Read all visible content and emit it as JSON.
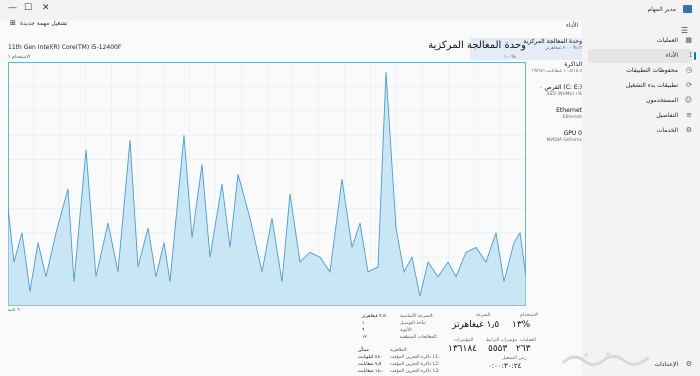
{
  "window": {
    "title": "مدير المهام",
    "controls": {
      "minimize": "—",
      "maximize": "☐",
      "close": "✕"
    }
  },
  "toolbar": {
    "page_title": "الأداء",
    "new_task_label": "تشغيل مهمة جديدة"
  },
  "nav": {
    "items": [
      {
        "label": "العمليات",
        "icon": "grid-icon"
      },
      {
        "label": "الأداء",
        "icon": "chart-icon",
        "active": true
      },
      {
        "label": "محفوظات التطبيقات",
        "icon": "history-icon"
      },
      {
        "label": "تطبيقات بدء التشغيل",
        "icon": "startup-icon"
      },
      {
        "label": "المستخدمون",
        "icon": "users-icon"
      },
      {
        "label": "التفاصيل",
        "icon": "list-icon"
      },
      {
        "label": "الخدمات",
        "icon": "puzzle-icon"
      }
    ],
    "settings_label": "الإعدادات"
  },
  "devices": [
    {
      "name": "وحدة المعالجة المركزية",
      "sub": "١٣% ٢.٠٠ غيغاهرتز",
      "active": true,
      "level": 0.2
    },
    {
      "name": "الذاكرة",
      "sub": "١٠.٥/١٥.٧ غيغابايت (٦٧%)",
      "active": false,
      "level": 0.67
    },
    {
      "name": "القرص ٠ (C: E:)",
      "sub": "SSD (NVMe) ١%",
      "active": false,
      "level": 0.05
    },
    {
      "name": "Ethernet",
      "sub": "Ethernet",
      "active": false,
      "level": 0.05
    },
    {
      "name": "GPU 0",
      "sub": "NVIDIA GeForce",
      "active": false,
      "level": 0.03
    }
  ],
  "cpu": {
    "title": "وحدة المعالجة المركزية",
    "model": "11th Gen Intel(R) Core(TM) i5-12400F",
    "graph_caption_left": "٪ الاستخدام",
    "graph_caption_right": "١٠٠%",
    "graph_foot_left": "٦٠ ثانية",
    "graph_foot_right": "٠",
    "accent": "#4a9cd6",
    "fill": "#c9e6f5",
    "usage_series": [
      20,
      9,
      16,
      5,
      17,
      8,
      12,
      18,
      24,
      6,
      30,
      8,
      17,
      9,
      32,
      12,
      14,
      8,
      15,
      7,
      20,
      10,
      28,
      9,
      23,
      10,
      25,
      18,
      11,
      14,
      7,
      13,
      10,
      9,
      17,
      12,
      19,
      14,
      11,
      8,
      6,
      12,
      11,
      32,
      19,
      12,
      7,
      21,
      9,
      13,
      13,
      16,
      14,
      18,
      23,
      12,
      15,
      14,
      16,
      17,
      11,
      13,
      10,
      9,
      27,
      20,
      13,
      12,
      16,
      15,
      8,
      17,
      14,
      22,
      28,
      20,
      11,
      16,
      12,
      30,
      17,
      7,
      16,
      9,
      10,
      6,
      13,
      12,
      15,
      12,
      14,
      9,
      10,
      6,
      14,
      8,
      17,
      10,
      6,
      10,
      9,
      8,
      11,
      7,
      15,
      16,
      18,
      20,
      28,
      30,
      23,
      16,
      21,
      13,
      15,
      9,
      13,
      8,
      12,
      18,
      20,
      17,
      10,
      15,
      12,
      17,
      15,
      11,
      14,
      6,
      13
    ]
  },
  "stats": {
    "utilization_label": "الاستخدام",
    "utilization_value": "١٣%",
    "speed_label": "السرعة",
    "speed_value": "١٫٥ غيغاهرتز",
    "processes_label": "العمليات",
    "processes_value": "٢٦٣",
    "threads_label": "مؤشرات الترابط",
    "threads_value": "٥٥٥٣",
    "handles_label": "المؤشرات",
    "handles_value": "١٣٦١٨٤",
    "uptime_label": "زمن التشغيل",
    "uptime_value": "٠:٠٠:٣٠:٢٤",
    "details": [
      {
        "label": "السرعة الأساسية:",
        "value": "٢.٥٠ غيغاهرتز"
      },
      {
        "label": "مآخذ التوصيل:",
        "value": "١"
      },
      {
        "label": "الأنوية:",
        "value": "٦"
      },
      {
        "label": "المعالجات المنطقية:",
        "value": "١٢"
      },
      {
        "label": "الظاهرية:",
        "value": "ممكّن"
      },
      {
        "label": "ذاكرة التخزين المؤقت L1:",
        "value": "٤٨٠ كيلوبايت"
      },
      {
        "label": "ذاكرة التخزين المؤقت L2:",
        "value": "٧٫٥ ميغابايت"
      },
      {
        "label": "ذاكرة التخزين المؤقت L3:",
        "value": "١٨٫٠ ميغابايت"
      }
    ]
  }
}
